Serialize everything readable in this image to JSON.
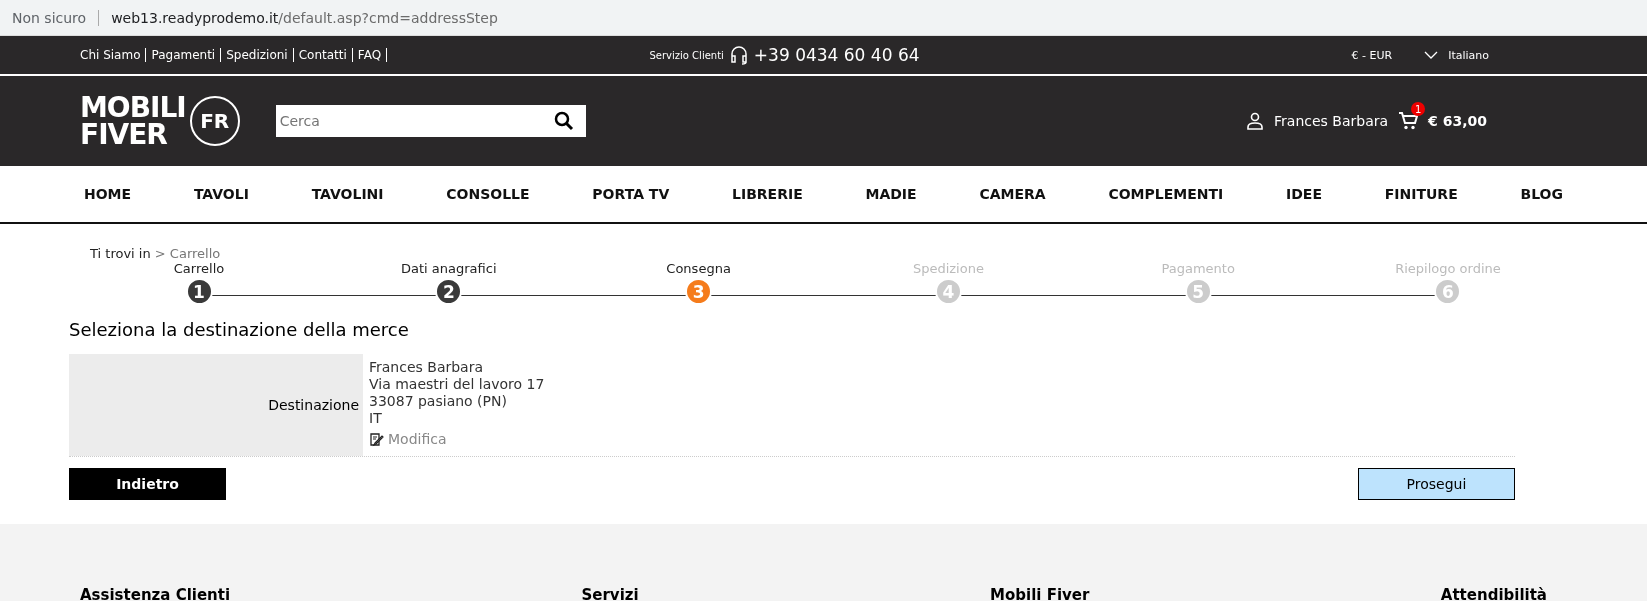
{
  "browser": {
    "security": "Non sicuro",
    "url_host": "web13.readyprodemo.it",
    "url_path": "/default.asp?cmd=addressStep"
  },
  "top_bar": {
    "links": [
      "Chi Siamo",
      "Pagamenti",
      "Spedizioni",
      "Contatti",
      "FAQ"
    ],
    "service_label": "Servizio Clienti",
    "phone": "+39 0434 60 40 64",
    "currency": "€ - EUR",
    "language": "Italiano"
  },
  "header": {
    "logo": {
      "lines": [
        "MOBILI",
        "FIVER"
      ],
      "mark": "FR"
    },
    "search": {
      "placeholder": "Cerca"
    },
    "user": "Frances Barbara",
    "cart_count": "1",
    "cart_total": "€ 63,00"
  },
  "nav": [
    "HOME",
    "TAVOLI",
    "TAVOLINI",
    "CONSOLLE",
    "PORTA TV",
    "LIBRERIE",
    "MADIE",
    "CAMERA",
    "COMPLEMENTI",
    "IDEE",
    "FINITURE",
    "BLOG"
  ],
  "breadcrumb": {
    "prefix": "Ti trovi in",
    "separator": ">",
    "current": "Carrello"
  },
  "steps": [
    {
      "label": "Carrello",
      "number": "1",
      "selected": false
    },
    {
      "label": "Dati anagrafici",
      "number": "2",
      "selected": false
    },
    {
      "label": "Consegna",
      "number": "3",
      "selected": true
    },
    {
      "label": "Spedizione",
      "number": "4",
      "selected": false
    },
    {
      "label": "Pagamento",
      "number": "5",
      "selected": false
    },
    {
      "label": "Riepilogo ordine",
      "number": "6",
      "selected": false
    }
  ],
  "heading": "Seleziona la destinazione della merce",
  "destination": {
    "label": "Destinazione",
    "lines": [
      "Frances Barbara",
      "Via maestri del lavoro 17",
      "33087 pasiano (PN)",
      "IT"
    ],
    "edit": "Modifica"
  },
  "buttons": {
    "back": "Indietro",
    "next": "Prosegui"
  },
  "footer": [
    "Assistenza Clienti",
    "Servizi",
    "Mobili Fiver",
    "Attendibilità"
  ]
}
